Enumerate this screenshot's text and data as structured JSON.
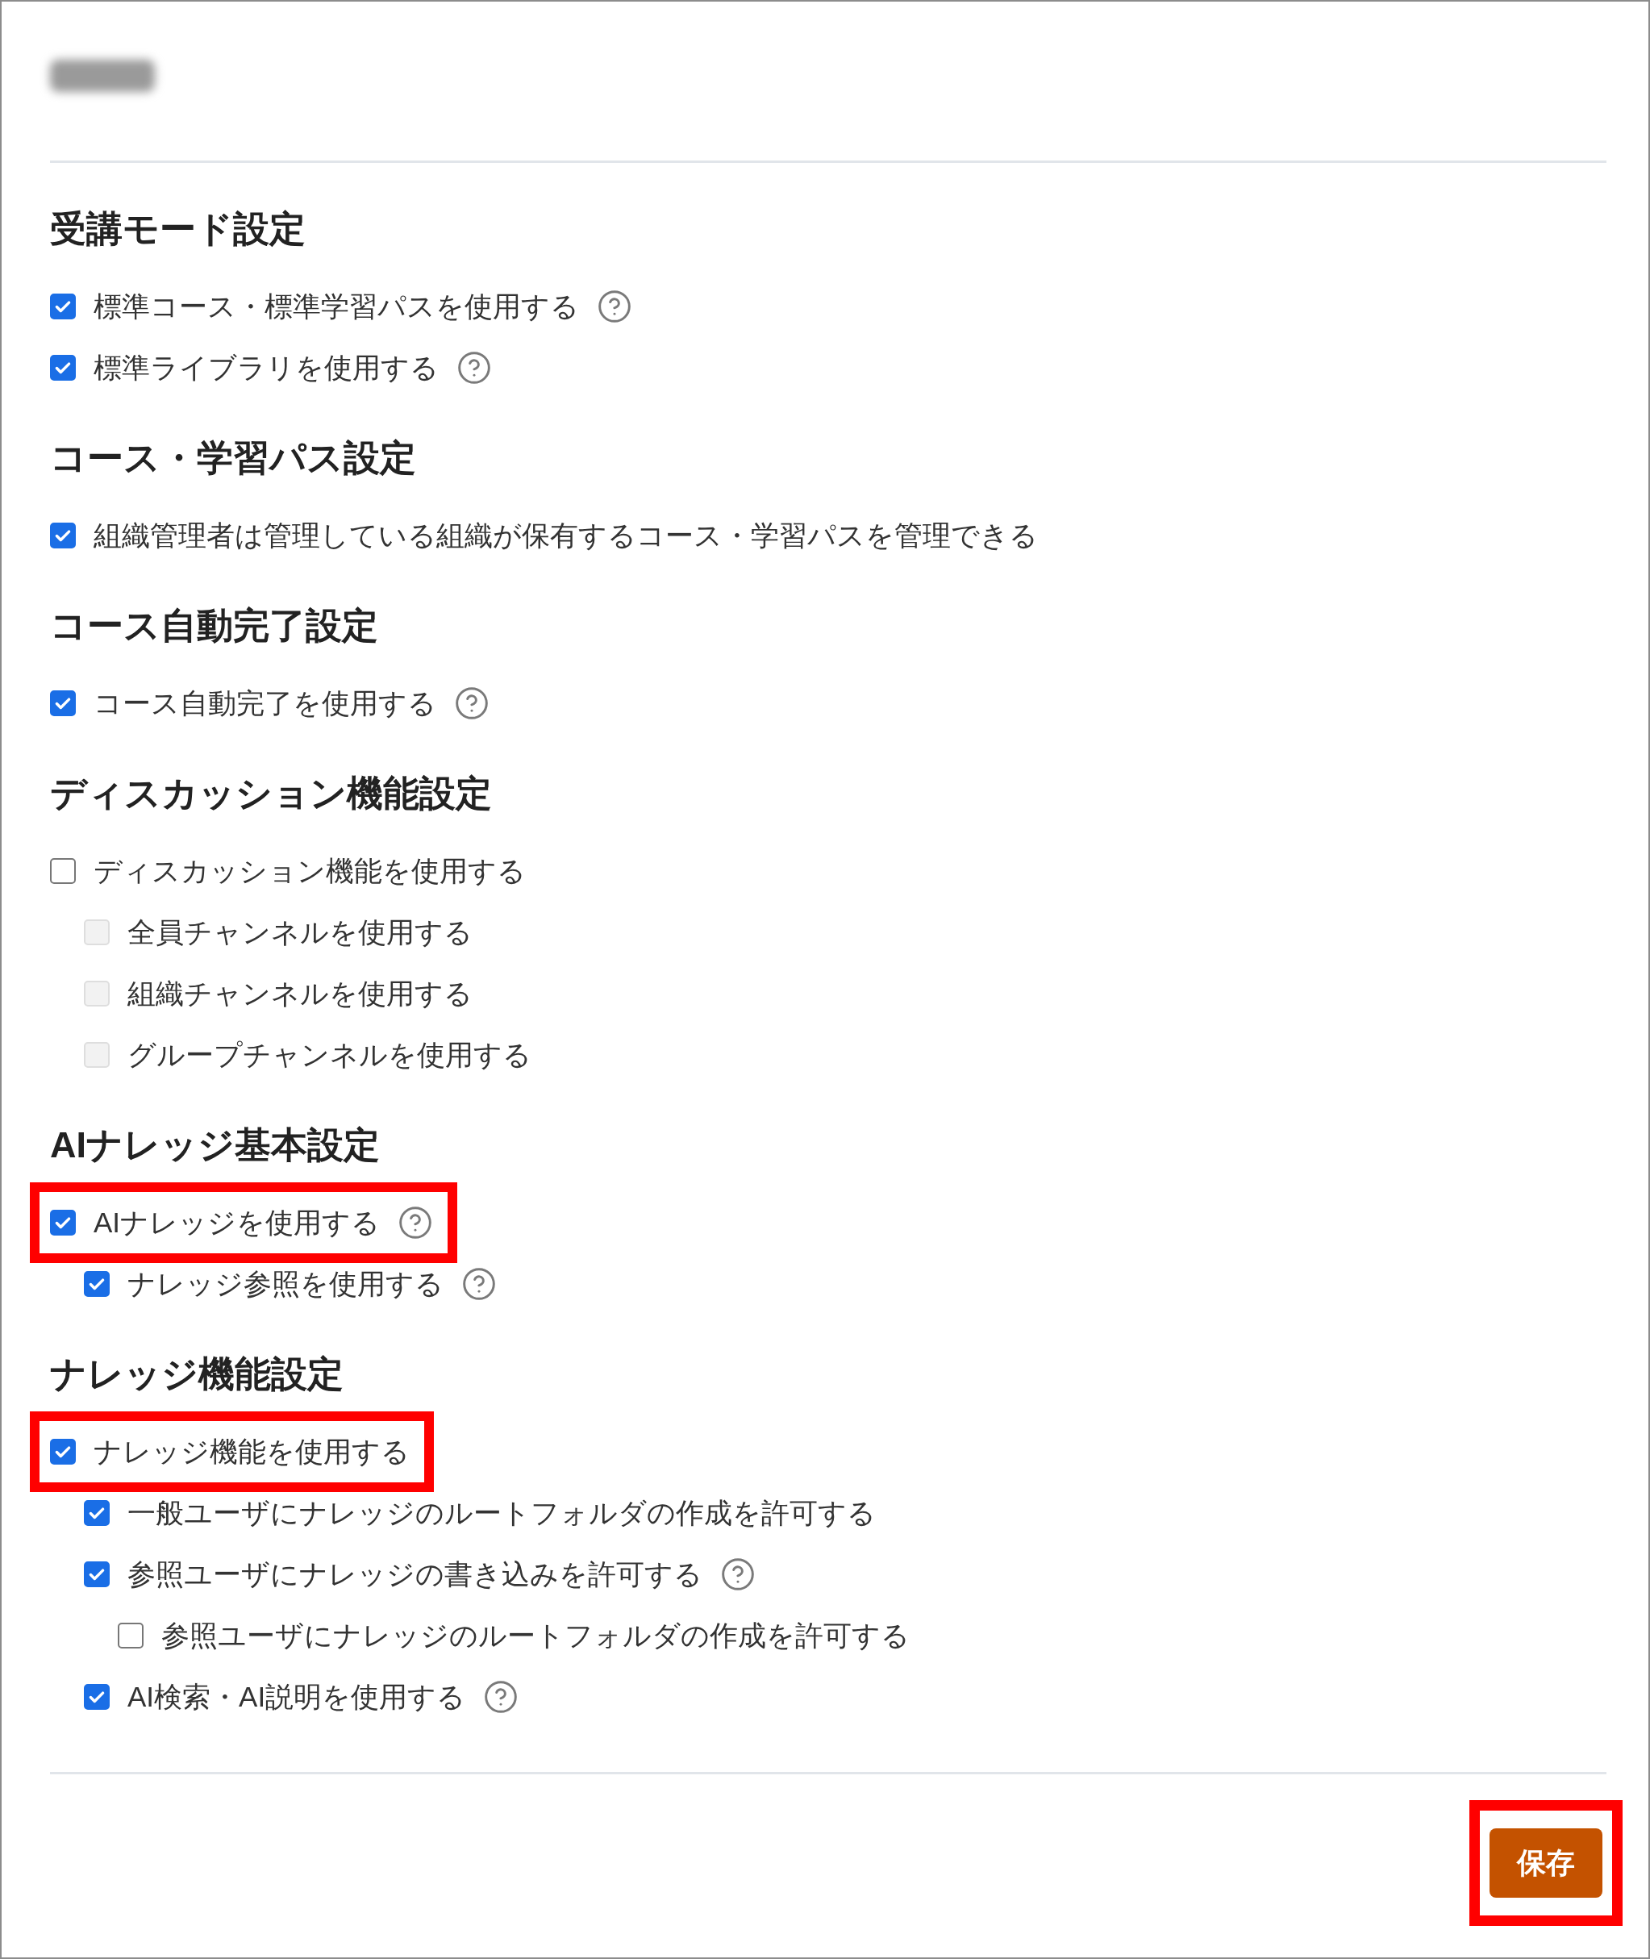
{
  "sections": [
    {
      "heading": "受講モード設定",
      "items": [
        {
          "label": "標準コース・標準学習パスを使用する",
          "checked": true,
          "disabled": false,
          "help": true,
          "highlighted": false
        },
        {
          "label": "標準ライブラリを使用する",
          "checked": true,
          "disabled": false,
          "help": true,
          "highlighted": false
        }
      ]
    },
    {
      "heading": "コース・学習パス設定",
      "items": [
        {
          "label": "組織管理者は管理している組織が保有するコース・学習パスを管理できる",
          "checked": true,
          "disabled": false,
          "help": false,
          "highlighted": false
        }
      ]
    },
    {
      "heading": "コース自動完了設定",
      "items": [
        {
          "label": "コース自動完了を使用する",
          "checked": true,
          "disabled": false,
          "help": true,
          "highlighted": false
        }
      ]
    },
    {
      "heading": "ディスカッション機能設定",
      "items": [
        {
          "label": "ディスカッション機能を使用する",
          "checked": false,
          "disabled": false,
          "help": false,
          "highlighted": false,
          "children": [
            {
              "label": "全員チャンネルを使用する",
              "checked": false,
              "disabled": true,
              "help": false,
              "highlighted": false
            },
            {
              "label": "組織チャンネルを使用する",
              "checked": false,
              "disabled": true,
              "help": false,
              "highlighted": false
            },
            {
              "label": "グループチャンネルを使用する",
              "checked": false,
              "disabled": true,
              "help": false,
              "highlighted": false
            }
          ]
        }
      ]
    },
    {
      "heading": "AIナレッジ基本設定",
      "items": [
        {
          "label": "AIナレッジを使用する",
          "checked": true,
          "disabled": false,
          "help": true,
          "highlighted": true,
          "children": [
            {
              "label": "ナレッジ参照を使用する",
              "checked": true,
              "disabled": false,
              "help": true,
              "highlighted": false
            }
          ]
        }
      ]
    },
    {
      "heading": "ナレッジ機能設定",
      "items": [
        {
          "label": "ナレッジ機能を使用する",
          "checked": true,
          "disabled": false,
          "help": false,
          "highlighted": true,
          "children": [
            {
              "label": "一般ユーザにナレッジのルートフォルダの作成を許可する",
              "checked": true,
              "disabled": false,
              "help": false,
              "highlighted": false
            },
            {
              "label": "参照ユーザにナレッジの書き込みを許可する",
              "checked": true,
              "disabled": false,
              "help": true,
              "highlighted": false,
              "children": [
                {
                  "label": "参照ユーザにナレッジのルートフォルダの作成を許可する",
                  "checked": false,
                  "disabled": false,
                  "help": false,
                  "highlighted": false
                }
              ]
            },
            {
              "label": "AI検索・AI説明を使用する",
              "checked": true,
              "disabled": false,
              "help": true,
              "highlighted": false
            }
          ]
        }
      ]
    }
  ],
  "save_button": {
    "label": "保存",
    "highlighted": true
  }
}
